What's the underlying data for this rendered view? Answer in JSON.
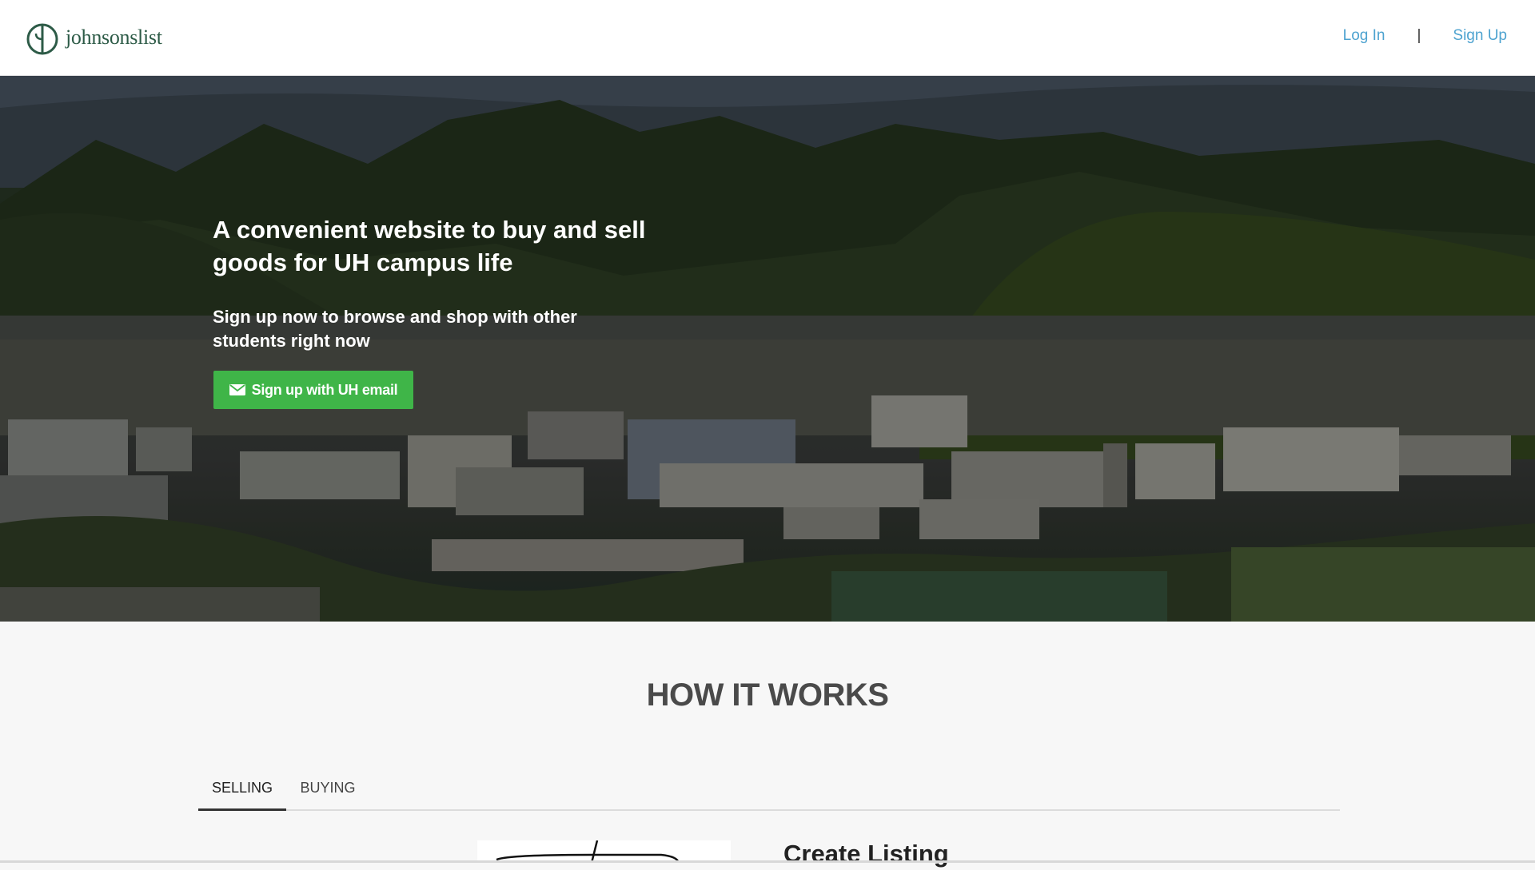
{
  "header": {
    "logo_text": "johnsonslist",
    "login_label": "Log In",
    "separator": "|",
    "signup_label": "Sign Up"
  },
  "hero": {
    "title": "A convenient website to buy and sell goods for UH campus life",
    "subtitle": "Sign up now to browse and shop with other students right now",
    "cta_label": "Sign up with UH email",
    "cta_icon": "envelope-icon"
  },
  "how_it_works": {
    "title": "HOW IT WORKS",
    "tabs": [
      {
        "label": "SELLING",
        "active": true
      },
      {
        "label": "BUYING",
        "active": false
      }
    ],
    "step_title": "Create Listing"
  },
  "colors": {
    "brand_green": "#2d5b47",
    "link_blue": "#4ea3d0",
    "cta_green": "#3fb548"
  }
}
